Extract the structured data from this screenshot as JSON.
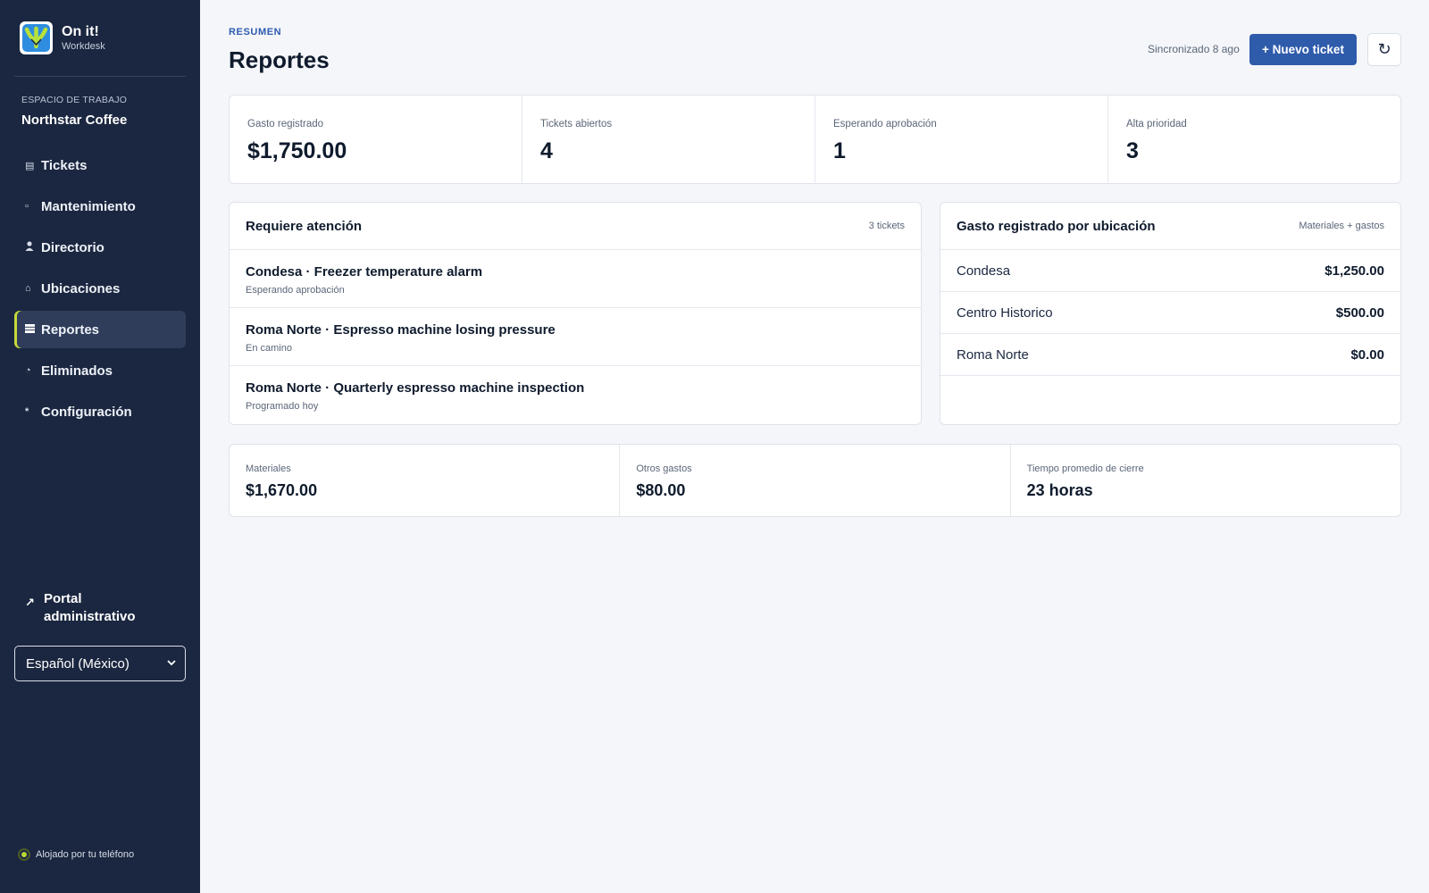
{
  "app": {
    "name": "On it!",
    "subtitle": "Workdesk"
  },
  "sidebar": {
    "workspace_label": "ESPACIO DE TRABAJO",
    "workspace_name": "Northstar Coffee",
    "items": [
      {
        "label": "Tickets",
        "icon": "list-icon",
        "glyph": "▤"
      },
      {
        "label": "Mantenimiento",
        "icon": "square-icon",
        "glyph": "▫"
      },
      {
        "label": "Directorio",
        "icon": "person-icon",
        "glyph": "👤"
      },
      {
        "label": "Ubicaciones",
        "icon": "home-icon",
        "glyph": "⌂"
      },
      {
        "label": "Reportes",
        "icon": "chart-icon",
        "glyph": "▦",
        "active": true
      },
      {
        "label": "Eliminados",
        "icon": "clock-icon",
        "glyph": "◔"
      },
      {
        "label": "Configuración",
        "icon": "asterisk-icon",
        "glyph": "*"
      }
    ],
    "portal_label": "Portal administrativo",
    "language": "Español (México)",
    "hosted": "Alojado por tu teléfono"
  },
  "header": {
    "kicker": "RESUMEN",
    "title": "Reportes",
    "sync": "Sincronizado 8 ago",
    "new_ticket": "+ Nuevo ticket"
  },
  "stats": [
    {
      "label": "Gasto registrado",
      "value": "$1,750.00"
    },
    {
      "label": "Tickets abiertos",
      "value": "4"
    },
    {
      "label": "Esperando aprobación",
      "value": "1"
    },
    {
      "label": "Alta prioridad",
      "value": "3"
    }
  ],
  "attention": {
    "title": "Requiere atención",
    "count": "3 tickets",
    "items": [
      {
        "title": "Condesa · Freezer temperature alarm",
        "status": "Esperando aprobación"
      },
      {
        "title": "Roma Norte · Espresso machine losing pressure",
        "status": "En camino"
      },
      {
        "title": "Roma Norte · Quarterly espresso machine inspection",
        "status": "Programado hoy"
      }
    ]
  },
  "spend_by_location": {
    "title": "Gasto registrado por ubicación",
    "meta": "Materiales + gastos",
    "rows": [
      {
        "location": "Condesa",
        "amount": "$1,250.00"
      },
      {
        "location": "Centro Historico",
        "amount": "$500.00"
      },
      {
        "location": "Roma Norte",
        "amount": "$0.00"
      }
    ]
  },
  "bottom_stats": [
    {
      "label": "Materiales",
      "value": "$1,670.00"
    },
    {
      "label": "Otros gastos",
      "value": "$80.00"
    },
    {
      "label": "Tiempo promedio de cierre",
      "value": "23 horas"
    }
  ],
  "colors": {
    "sidebar": "#1b2740",
    "accent": "#2f5bab",
    "active_marker": "#c6d83a"
  }
}
